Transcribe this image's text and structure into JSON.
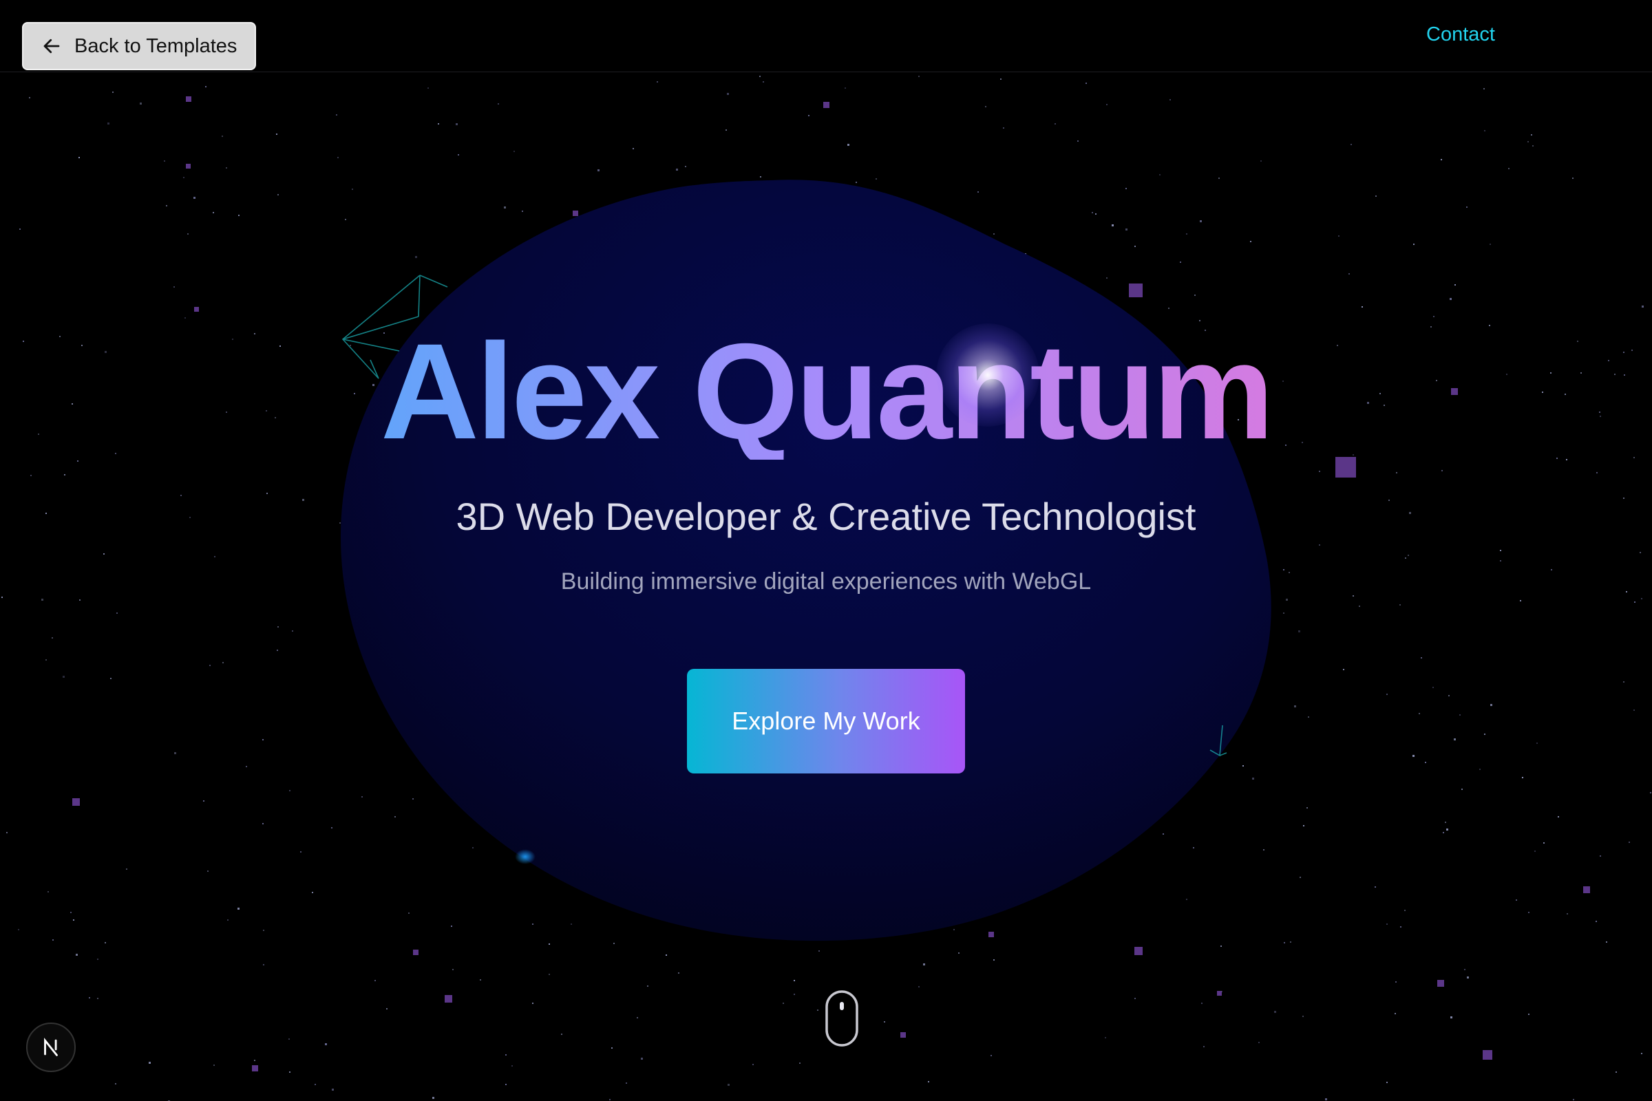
{
  "header": {
    "back_label": "Back to Templates",
    "contact_label": "Contact"
  },
  "hero": {
    "title": "Alex Quantum",
    "subtitle": "3D Web Developer & Creative Technologist",
    "tagline": "Building immersive digital experiences with WebGL",
    "cta_label": "Explore My Work"
  },
  "icons": {
    "back": "arrow-left-icon",
    "scroll": "mouse-scroll-icon",
    "badge": "nextjs-logo-icon"
  },
  "colors": {
    "background": "#000000",
    "accent_cyan": "#22d3ee",
    "accent_purple": "#a855f7",
    "accent_pink": "#f472b6",
    "blob": "#050845",
    "particle_purple": "#6b3fa0"
  }
}
